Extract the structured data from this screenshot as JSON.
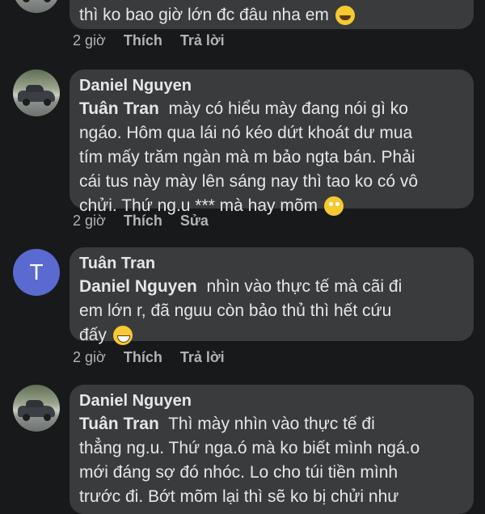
{
  "comments": [
    {
      "text": "thì ko bao giờ lớn đc đâu nha em",
      "emoji": "rolling-on-floor-laughing-icon",
      "actions": {
        "time": "2 giờ",
        "like": "Thích",
        "reply": "Trả lời"
      }
    },
    {
      "author": "Daniel Nguyen",
      "mention": "Tuân Tran",
      "line1": "mày có hiểu mày đang nói gì ko",
      "line2": "ngáo. Hôm qua lái nó kéo dứt khoát dư mua",
      "line3": "tím mấy trăm ngàn mà m bảo ngta bán. Phải",
      "line4": "cái tus này mày lên sáng nay thì tao ko có vô",
      "line5": "chửi. Thứ ng.u *** mà hay mõm",
      "emoji": "face-with-rolling-eyes-icon",
      "actions": {
        "time": "2 giờ",
        "like": "Thích",
        "reply": "Sửa"
      }
    },
    {
      "author": "Tuân Tran",
      "avatar_letter": "T",
      "mention": "Daniel Nguyen",
      "line1": "nhìn vào thực tế mà cãi đi",
      "line2": "em lớn r, đã nguu còn bảo thủ thì hết cứu",
      "line3": "đấy",
      "emoji": "grinning-face-icon",
      "actions": {
        "time": "2 giờ",
        "like": "Thích",
        "reply": "Trả lời"
      }
    },
    {
      "author": "Daniel Nguyen",
      "mention": "Tuân Tran",
      "line1": "Thì mày nhìn vào thực tế đi",
      "line2": "thẳng ng.u. Thứ nga.ó mà ko biết mình ngá.o",
      "line3": "mới đáng sợ đó nhóc. Lo cho túi tiền mình",
      "line4": "trước đi. Bớt mõm lại thì sẽ ko bị chửi như"
    }
  ]
}
